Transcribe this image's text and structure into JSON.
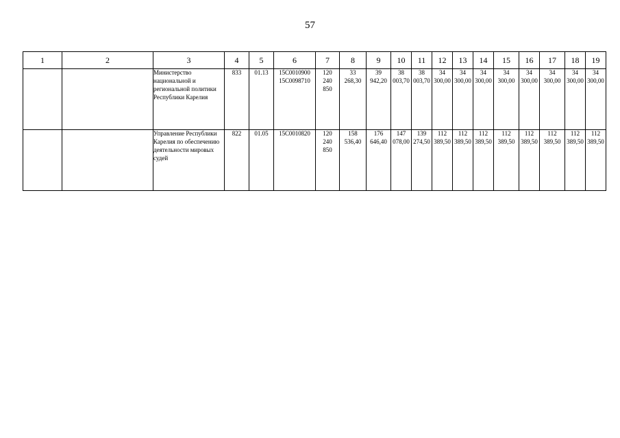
{
  "page": {
    "number": "57"
  },
  "table": {
    "column_headers": [
      "1",
      "2",
      "3",
      "4",
      "5",
      "6",
      "7",
      "8",
      "9",
      "10",
      "11",
      "12",
      "13",
      "14",
      "15",
      "16",
      "17",
      "18",
      "19"
    ],
    "rows": [
      {
        "col1": "",
        "col2": "",
        "name": "Министерство национальной и региональной политики Республики Карелия",
        "col4": "833",
        "col5": "01.13",
        "code_line1": "15С0010900",
        "code_line2": "15С0098710",
        "col7_line1": "120",
        "col7_line2": "240",
        "col7_line3": "850",
        "col8_line1": "33",
        "col8_line2": "268,30",
        "col9_line1": "39",
        "col9_line2": "942,20",
        "col10_line1": "38",
        "col10_line2": "003,70",
        "col11_line1": "38",
        "col11_line2": "003,70",
        "col12_line1": "34",
        "col12_line2": "300,00",
        "col13_line1": "34",
        "col13_line2": "300,00",
        "col14_line1": "34",
        "col14_line2": "300,00",
        "col15_line1": "34",
        "col15_line2": "300,00",
        "col16_line1": "34",
        "col16_line2": "300,00",
        "col17_line1": "34",
        "col17_line2": "300,00",
        "col18_line1": "34",
        "col18_line2": "300,00",
        "col19_line1": "34",
        "col19_line2": "300,00"
      },
      {
        "col1": "",
        "col2": "",
        "name": "Управление Республики Карелия по обеспечению деятельности мировых судей",
        "col4": "822",
        "col5": "01.05",
        "code_line1": "15С0010820",
        "code_line2": "",
        "col7_line1": "120",
        "col7_line2": "240",
        "col7_line3": "850",
        "col8_line1": "158",
        "col8_line2": "536,40",
        "col9_line1": "176",
        "col9_line2": "646,40",
        "col10_line1": "147",
        "col10_line2": "078,00",
        "col11_line1": "139",
        "col11_line2": "274,50",
        "col12_line1": "112",
        "col12_line2": "389,50",
        "col13_line1": "112",
        "col13_line2": "389,50",
        "col14_line1": "112",
        "col14_line2": "389,50",
        "col15_line1": "112",
        "col15_line2": "389,50",
        "col16_line1": "112",
        "col16_line2": "389,50",
        "col17_line1": "112",
        "col17_line2": "389,50",
        "col18_line1": "112",
        "col18_line2": "389,50",
        "col19_line1": "112",
        "col19_line2": "389,50"
      }
    ]
  }
}
